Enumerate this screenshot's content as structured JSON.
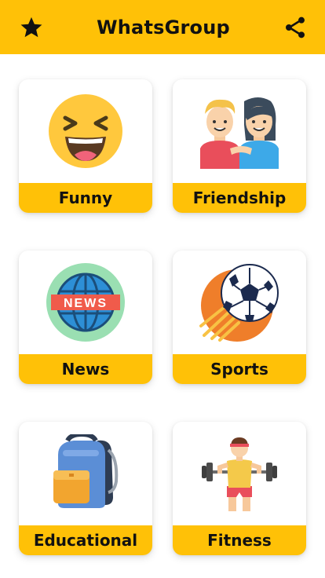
{
  "app": {
    "title": "WhatsGroup",
    "bar_color": "#FFC107",
    "left_icon": "star-icon",
    "right_icon": "share-icon"
  },
  "categories": [
    {
      "label": "Funny",
      "icon": "laughing-face-icon"
    },
    {
      "label": "Friendship",
      "icon": "friends-icon"
    },
    {
      "label": "News",
      "icon": "news-globe-icon"
    },
    {
      "label": "Sports",
      "icon": "soccer-ball-icon"
    },
    {
      "label": "Educational",
      "icon": "backpack-icon"
    },
    {
      "label": "Fitness",
      "icon": "weightlifter-icon"
    }
  ]
}
